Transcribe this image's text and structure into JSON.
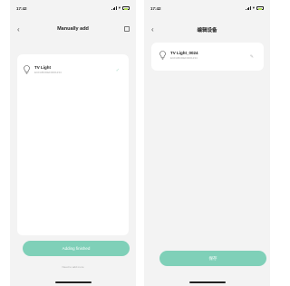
{
  "left_screen": {
    "status_time": "17:42",
    "title": "Manually add",
    "device": {
      "name": "TV Light",
      "sub": "ECFABCDEF0001234"
    },
    "button_label": "Adding finished",
    "hint": "Need to add more"
  },
  "right_screen": {
    "status_time": "17:42",
    "title": "编辑设备",
    "device": {
      "name": "TV Light_0024",
      "sub": "ECFABCDEF0001234"
    },
    "button_label": "保存"
  },
  "colors": {
    "accent": "#7fd0b8",
    "screen_bg": "#f3f3f3",
    "battery": "#b3e05a"
  },
  "icons": [
    "back-chevron-icon",
    "scan-icon",
    "bulb-icon",
    "check-icon",
    "edit-icon",
    "signal-icon",
    "wifi-icon",
    "battery-icon"
  ]
}
